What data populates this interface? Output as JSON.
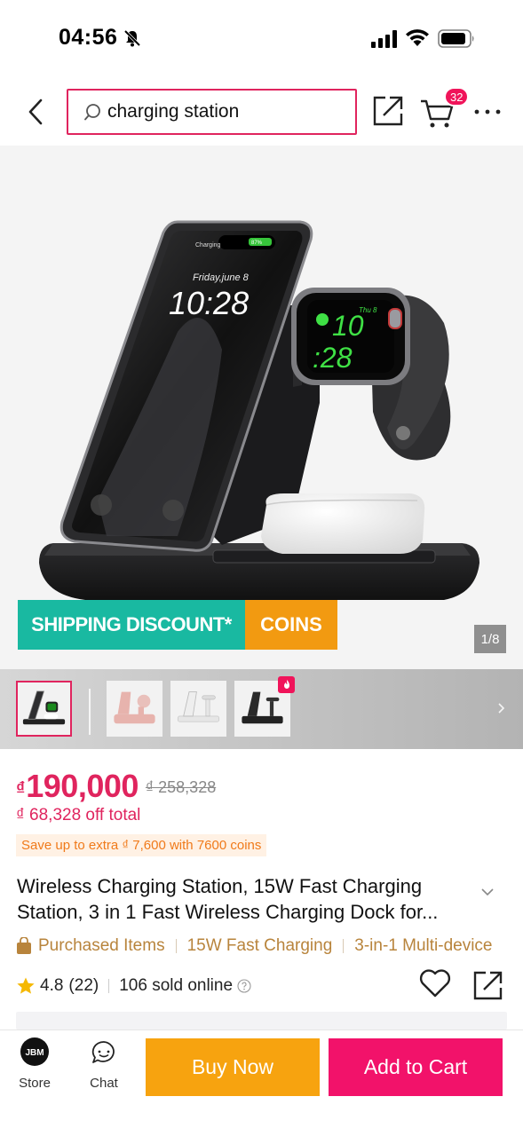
{
  "status_bar": {
    "time": "04:56"
  },
  "header": {
    "search_query": "charging station",
    "cart_count": "32"
  },
  "gallery": {
    "promo_shipping": "SHIPPING DISCOUNT*",
    "promo_coins": "COINS",
    "counter": "1/8",
    "phone_screen": {
      "status": "Charging",
      "battery": "87%",
      "date": "Friday,june 8",
      "time": "10:28"
    },
    "watch_screen": {
      "date": "Thu 8",
      "hour": "10",
      "minute": ":28"
    },
    "thumbnails": [
      {
        "variant": "black",
        "selected": true
      },
      {
        "variant": "pink",
        "selected": false
      },
      {
        "variant": "white",
        "selected": false
      },
      {
        "variant": "black-folded",
        "selected": false,
        "hot": true
      }
    ]
  },
  "price": {
    "currency": "₫",
    "current": "190,000",
    "original": "₫ 258,328",
    "off_total": "₫ 68,328 off total",
    "coin_save": "Save up to extra ₫ 7,600 with 7600 coins"
  },
  "product": {
    "title_line1": "Wireless Charging Station, 15W Fast Charging",
    "title_line2": "Station, 3 in 1 Fast Wireless Charging Dock for..."
  },
  "tags": [
    "Purchased Items",
    "15W Fast Charging",
    "3-in-1 Multi-device"
  ],
  "rating": {
    "score": "4.8",
    "count": "(22)",
    "sold": "106 sold online"
  },
  "bottom_bar": {
    "store_label": "Store",
    "store_logo_text": "JBM",
    "chat_label": "Chat",
    "buy_now": "Buy Now",
    "add_to_cart": "Add to Cart"
  },
  "colors": {
    "accent_pink": "#e0245e",
    "buy_now_orange": "#f7a30f",
    "add_to_cart_pink": "#f2126a",
    "promo_teal": "#19b9a1",
    "promo_orange": "#f29a11",
    "tag_gold": "#b8843c"
  }
}
